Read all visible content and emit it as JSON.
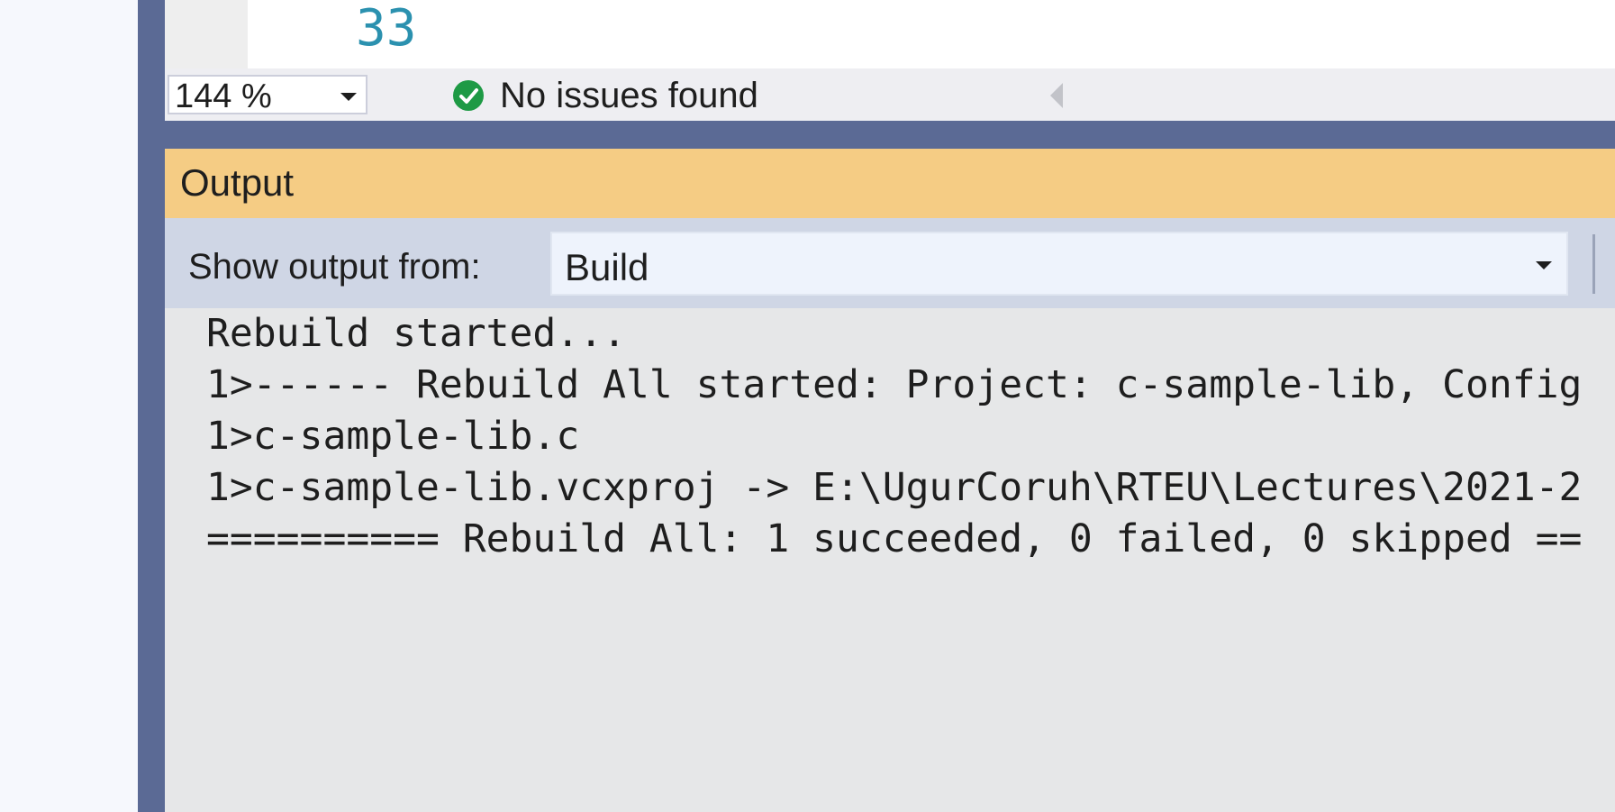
{
  "editor": {
    "line_number": "33"
  },
  "status_bar": {
    "zoom": "144 %",
    "issues_text": "No issues found"
  },
  "output_panel": {
    "title": "Output",
    "show_output_label": "Show output from:",
    "source_selected": "Build",
    "lines": [
      "Rebuild started...",
      "1>------ Rebuild All started: Project: c-sample-lib, Config",
      "1>c-sample-lib.c",
      "1>c-sample-lib.vcxproj -> E:\\UgurCoruh\\RTEU\\Lectures\\2021-2",
      "========== Rebuild All: 1 succeeded, 0 failed, 0 skipped =="
    ]
  },
  "colors": {
    "frame": "#5b6a95",
    "output_header": "#f5cc84",
    "toolbar": "#cfd6e5",
    "output_body": "#e6e7e8",
    "line_number": "#2b91af",
    "success_icon": "#1e9a45"
  },
  "icons": {
    "issues": "check-circle-icon",
    "zoom_dropdown": "chevron-down-icon",
    "source_dropdown": "chevron-down-icon",
    "scroll_left": "caret-left-icon"
  }
}
